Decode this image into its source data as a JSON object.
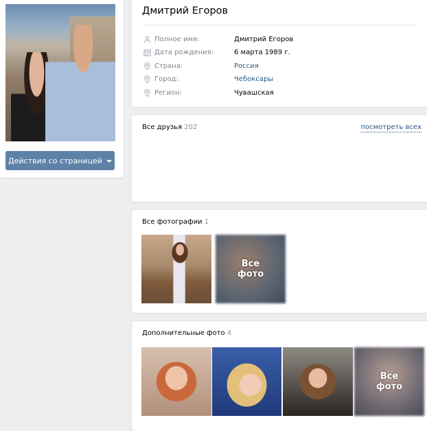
{
  "profile": {
    "name": "Дмитрий Егоров",
    "actions_button": "Действия со страницей",
    "fields": [
      {
        "icon": "person-icon",
        "label": "Полное имя:",
        "value": "Дмитрий Егоров",
        "link": false
      },
      {
        "icon": "calendar-icon",
        "label": "Дата рождения:",
        "value": "6 марта 1989 г.",
        "link": false
      },
      {
        "icon": "location-pin-icon",
        "label": "Страна:",
        "value": "Россия",
        "link": true
      },
      {
        "icon": "location-pin-icon",
        "label": "Город:",
        "value": "Чебоксары",
        "link": true
      },
      {
        "icon": "location-pin-icon",
        "label": "Регион:",
        "value": "Чувашская",
        "link": false
      }
    ]
  },
  "friends": {
    "title": "Все друзья",
    "count": "202",
    "see_all": "посмотреть всех"
  },
  "photos": {
    "title": "Все фотографии",
    "count": "1",
    "all_label_line1": "Все",
    "all_label_line2": "фото"
  },
  "extra_photos": {
    "title": "Дополнительные фото",
    "count": "4",
    "all_label_line1": "Все",
    "all_label_line2": "фото"
  },
  "colors": {
    "background": "#edeef0",
    "button": "#5e81a8",
    "link": "#2a5885",
    "muted": "#828282"
  }
}
